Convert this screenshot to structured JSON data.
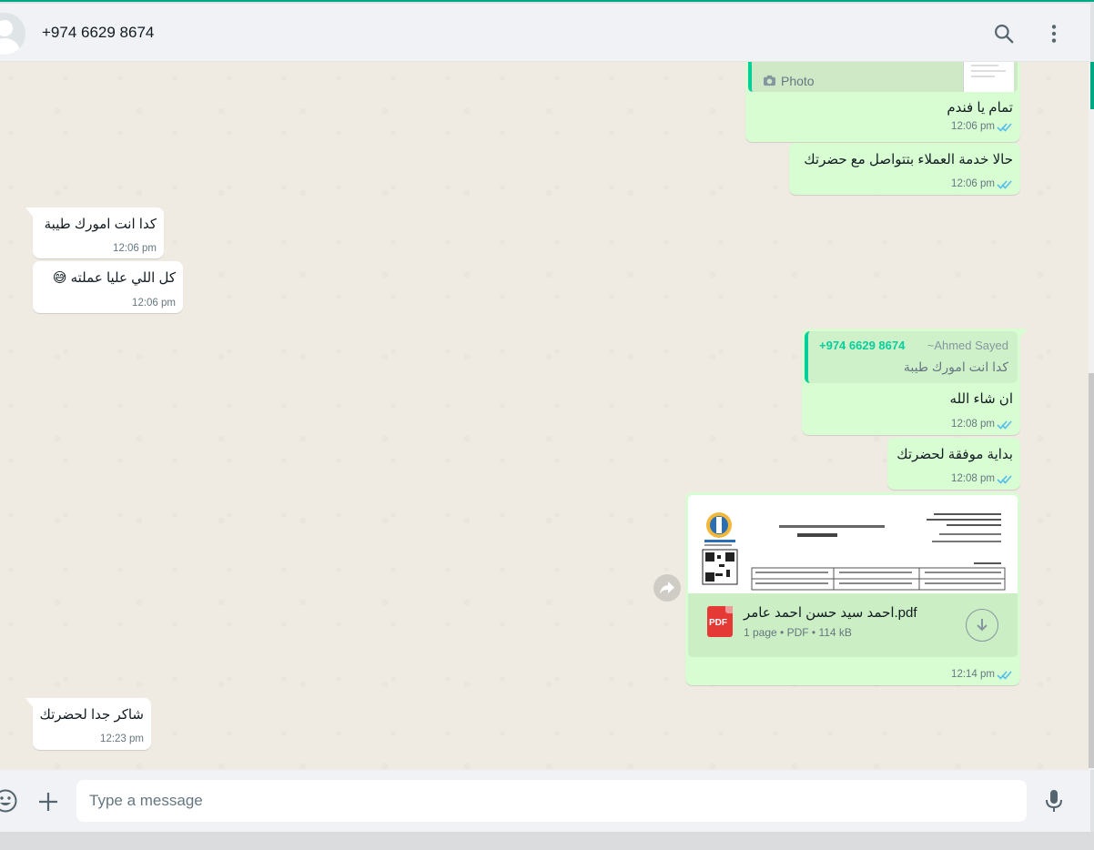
{
  "header": {
    "contact": "+974 6629 8674"
  },
  "messages": [
    {
      "id": "m1",
      "direction": "out",
      "photo_label": "Photo",
      "text": "تمام يا فندم",
      "time": "12:06 pm"
    },
    {
      "id": "m2",
      "direction": "out",
      "text": "حالا خدمة العملاء بتتواصل مع حضرتك",
      "time": "12:06 pm"
    },
    {
      "id": "m3",
      "direction": "in",
      "text": "كدا انت امورك طيبة",
      "time": "12:06 pm"
    },
    {
      "id": "m4",
      "direction": "in",
      "text": "كل اللي عليا عملته 😅",
      "time": "12:06 pm"
    },
    {
      "id": "m5",
      "direction": "out",
      "quote_phone": "+974 6629 8674",
      "quote_author": "~Ahmed Sayed",
      "quote_text": "كدا انت امورك طيبة",
      "text": "ان شاء الله",
      "time": "12:08 pm"
    },
    {
      "id": "m6",
      "direction": "out",
      "text": "بداية موفقة لحضرتك",
      "time": "12:08 pm"
    },
    {
      "id": "m7",
      "direction": "out",
      "file_name": "احمد سيد حسن احمد عامر.pdf",
      "file_meta": "1 page • PDF • 114 kB",
      "file_badge": "PDF",
      "time": "12:14 pm"
    },
    {
      "id": "m8",
      "direction": "in",
      "text": "شاكر جدا لحضرتك",
      "time": "12:23 pm"
    }
  ],
  "composer": {
    "placeholder": "Type a message"
  },
  "colors": {
    "accent": "#00a884",
    "outgoing_bubble": "#d9fdd3",
    "incoming_bubble": "#ffffff",
    "read_ticks": "#53bdeb"
  }
}
